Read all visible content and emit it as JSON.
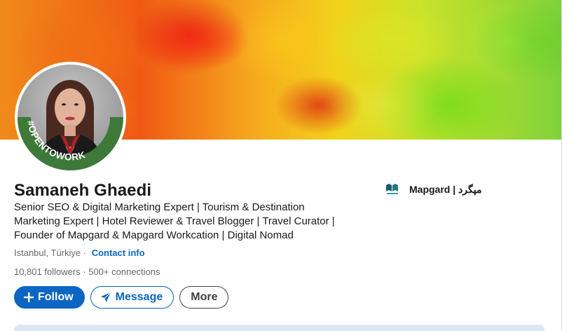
{
  "profile": {
    "name": "Samaneh Ghaedi",
    "headline_line1": "Senior SEO & Digital Marketing Expert | Tourism & Destination",
    "headline_line2": "Marketing Expert | Hotel Reviewer & Travel Blogger | Travel Curator |",
    "headline_line3": "Founder of Mapgard & Mapgard Workcation | Digital Nomad",
    "location": "Istanbul, Türkiye",
    "separator": " · ",
    "contact_info": "Contact info",
    "followers": "10,801 followers",
    "dot": " · ",
    "connections": "500+ connections",
    "open_to_work_badge": "#OPENTOWORK"
  },
  "company": {
    "label": "Mapgard | مپگرد",
    "logo_text": "Mapgard"
  },
  "actions": {
    "follow_label": "Follow",
    "message_label": "Message",
    "more_label": "More"
  },
  "colors": {
    "primary": "#0a66c2",
    "open_to_work_green": "#3d7a3a"
  },
  "icons": {
    "follow": "plus-icon",
    "message": "send-icon",
    "company": "mapgard-logo"
  }
}
